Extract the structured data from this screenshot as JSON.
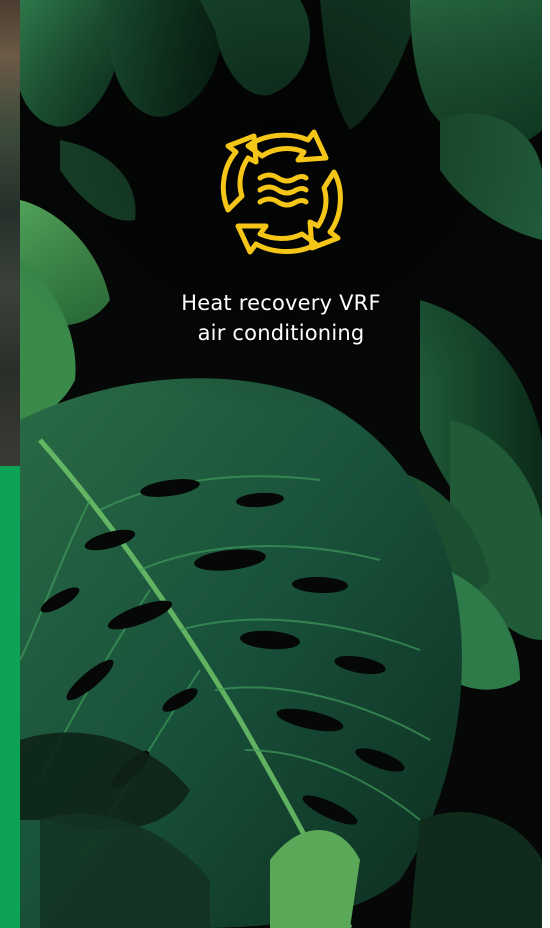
{
  "colors": {
    "accent": "#f5c518",
    "side_green": "#0da356",
    "card_bg": "#050806"
  },
  "feature": {
    "icon": "heat-recovery-cycle-icon",
    "line1": "Heat recovery VRF",
    "line2": "air conditioning"
  },
  "background": {
    "image": "monstera-leaves-photo"
  }
}
